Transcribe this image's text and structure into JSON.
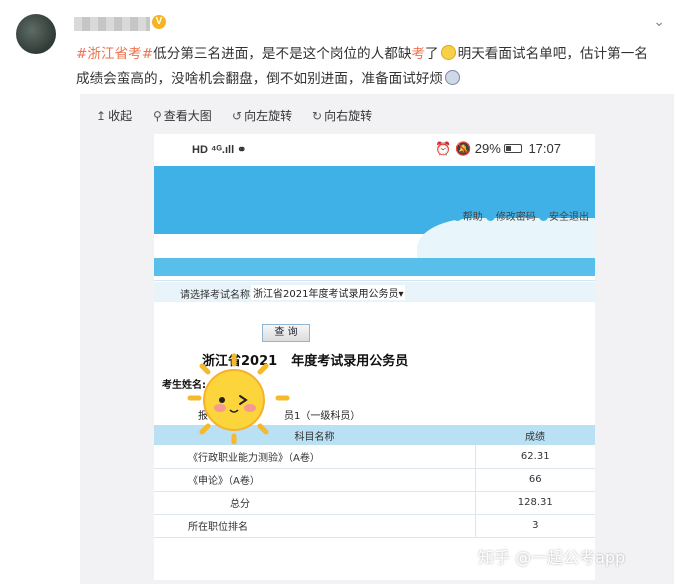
{
  "post": {
    "username_blurred": true,
    "verified_badge": "V",
    "hashtag": "#浙江省考#",
    "text_part1": "低分第三名进面，是不是这个岗位的人都缺",
    "highlight": "考",
    "text_part2": "了",
    "text_part3": "明天看面试名单吧，估计第一名成绩会蛮高的，没啥机会翻盘，倒不如别进面，准备面试好烦",
    "emoji1": "smile-emoji-icon",
    "emoji2": "sad-emoji-icon"
  },
  "toolbar": {
    "collapse": "收起",
    "view_large": "查看大图",
    "rotate_left": "向左旋转",
    "rotate_right": "向右旋转"
  },
  "phone": {
    "status_left": "HD ⁴ᴳ.ıll ⚭",
    "battery": "29%",
    "time": "17:07",
    "nav_help": "帮助",
    "nav_change_pw": "修改密码",
    "nav_logout": "安全退出",
    "select_label": "请选择考试名称:",
    "select_value": "浙江省2021年度考试录用公务员",
    "query_button": "查 询",
    "exam_title": "浙江省2021年度考试录用公务员",
    "exam_title_visible_left": "浙江省2021",
    "exam_title_visible_right": "年度考试录用公务员",
    "candidate_label": "考生姓名:",
    "post_label": "报",
    "post_value": "员1（一级科员）",
    "table": {
      "headers": [
        "科目名称",
        "成绩"
      ],
      "rows": [
        [
          "《行政职业能力测验》（A卷）",
          "62.31"
        ],
        [
          "《申论》（A卷）",
          "66"
        ],
        [
          "总分",
          "128.31"
        ],
        [
          "所在职位排名",
          "3"
        ]
      ]
    }
  },
  "watermark": "知乎 @一起公考app",
  "colors": {
    "hashtag": "#eb7350",
    "banner": "#3fb1e6",
    "table_header": "#b9e0f3"
  }
}
